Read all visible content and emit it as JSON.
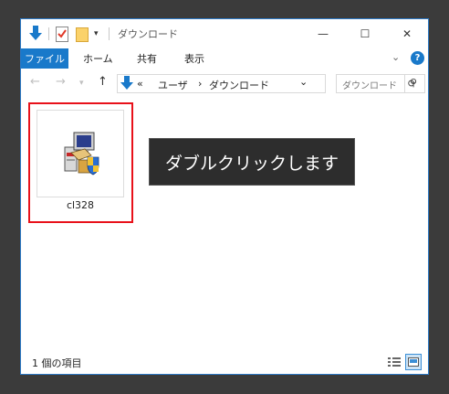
{
  "window": {
    "title": "ダウンロード",
    "controls": {
      "minimize": "—",
      "maximize": "☐",
      "close": "✕"
    }
  },
  "ribbon": {
    "tabs": [
      {
        "label": "ファイル",
        "active": true
      },
      {
        "label": "ホーム"
      },
      {
        "label": "共有"
      },
      {
        "label": "表示"
      }
    ],
    "help": "?"
  },
  "address": {
    "overflow": "«",
    "crumbs": [
      "ユーザ",
      "ダウンロード"
    ],
    "separator": "›",
    "dropdown": "⌄"
  },
  "search": {
    "placeholder": "ダウンロード"
  },
  "files": [
    {
      "name": "cl328",
      "icon": "installer-computer-icon",
      "highlighted": true
    }
  ],
  "callout": {
    "text": "ダブルクリックします"
  },
  "status": {
    "item_count": "1 個の項目"
  },
  "colors": {
    "accent": "#1979ca",
    "highlight_border": "#e8111a",
    "callout_bg": "#2d2d2d",
    "background": "#3b3b3b"
  }
}
